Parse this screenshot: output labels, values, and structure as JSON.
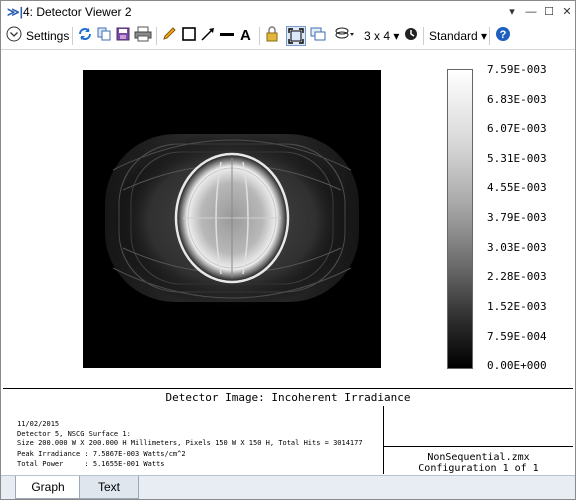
{
  "window": {
    "title": "4: Detector Viewer 2",
    "controls": [
      "minimize-icon",
      "restore-icon",
      "close-icon"
    ]
  },
  "toolbar": {
    "settings_label": "Settings",
    "layout_label": "3 x 4",
    "style_label": "Standard",
    "icons": [
      "chevron-down-circle-icon",
      "refresh-icon",
      "copy-icon",
      "save-icon",
      "print-icon",
      "pencil-icon",
      "rectangle-icon",
      "arrow-icon",
      "line-icon",
      "text-icon",
      "lock-icon",
      "fit-icon",
      "windows-icon",
      "layers-icon",
      "clock-icon",
      "help-icon"
    ]
  },
  "colorbar": {
    "labels": [
      "7.59E-003",
      "6.83E-003",
      "6.07E-003",
      "5.31E-003",
      "4.55E-003",
      "3.79E-003",
      "3.03E-003",
      "2.28E-003",
      "1.52E-003",
      "7.59E-004",
      "0.00E+000"
    ]
  },
  "caption": "Detector Image: Incoherent Irradiance",
  "info": {
    "date": "11/02/2015",
    "detector": "Detector 5, NSCG Surface 1:",
    "size": "Size 200.000 W X 200.000 H Millimeters, Pixels 150 W X 150 H, Total Hits = 3014177",
    "peak": "Peak Irradiance : 7.5867E-003 Watts/cm^2",
    "total": "Total Power     : 5.1655E-001 Watts"
  },
  "config": {
    "file": "NonSequential.zmx",
    "configuration": "Configuration 1 of 1"
  },
  "tabs": [
    "Graph",
    "Text"
  ]
}
